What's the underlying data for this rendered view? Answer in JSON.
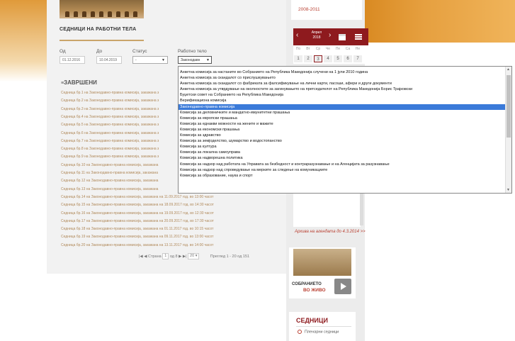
{
  "archive_years": "2008-2011",
  "section_title": "СЕДНИЦИ НА РАБОТНИ ТЕЛА",
  "filters": {
    "from_label": "Од",
    "from_value": "01.12.2016",
    "to_label": "До",
    "to_value": "10.04.2019",
    "status_label": "Статус",
    "status_value": "-",
    "body_label": "Работно тело",
    "body_value": "Законодавн"
  },
  "calendar": {
    "month": "Април",
    "year": "2018",
    "days": [
      "По",
      "Вт",
      "Ср",
      "Че",
      "Пе",
      "Са",
      "Не"
    ],
    "nums": [
      "1",
      "2",
      "3",
      "4",
      "5",
      "6",
      "7"
    ]
  },
  "completed_title": "ЗАВРШЕНИ",
  "sessions": [
    "Седница бр.1 на Законодавно-правна комисија, закажана з",
    "Седница бр.2 на Законодавно-правна комисија, закажана з",
    "Седница бр.3 на Законодавно-правна комисија, закажана з",
    "Седница бр.4 на Законодавно-правна комисија, закажана з",
    "Седница бр.5 на Законодавно-правна комисија, закажана з",
    "Седница бр.6 на Законодавно-правна комисија, закажана з",
    "Седница бр.7 на Законодавно-правна комисија, закажана з",
    "Седница бр.8 на Законодавно-правна комисија, закажана з",
    "Седница бр.9 на Законодавно-правна комисија, закажана з",
    "Седница бр.10 на Законодавно-правна комисија, закажана",
    "Седница бр.11 на Законодавно-правна комисија, закажана",
    "Седница бр.12 на Законодавно-правна комисија, закажана",
    "Седница бр.13 на Законодавно-правна комисија, закажана",
    "Седница бр.14 на Законодавно-правна комисија, закажана на 11.09.2017 год. во 13:00 часот",
    "Седница бр.15 на Законодавно-правна комисија, закажана на 18.09.2017 год. во 14:30 часот",
    "Седница бр.16 на Законодавно-правна комисија, закажана на 19.09.2017 год. во 12:30 часот",
    "Седница бр.17 на Законодавно-правна комисија, закажана на 20.09.2017 год. во 17:30 часот",
    "Седница бр.18 на Законодавно-правна комисија, закажана на 01.11.2017 год. во 10:15 часот",
    "Седница бр.19 на Законодавно-правна комисија, закажана на 09.11.2017 год. во 13:00 часот",
    "Седница бр.20 на Законодавно-правна комисија, закажана на 13.11.2017 год. во 14:00 часот"
  ],
  "pager": {
    "prefix": "Страна",
    "page": "1",
    "of": "од 8",
    "per_page": "20",
    "summary": "Преглед 1 - 20 од 151"
  },
  "dropdown_options": [
    "Анкетна комисија за настаните во Собранието на Република Македонија случени на 1 јули 2010 година",
    "Анкетна комисија за скандалот со прислушкувањето",
    "Анкетна комисија за скандалот со фабриката за фалсификување на лични карти, пасоши, афери и други документи",
    "Анкетна комисија за утврдување на околностите за загинувањето на претседателот на Република Македонија Борис Трајковски",
    "Буџетски совет на Собранието на Република Македонија",
    "Верификациона комисија",
    "Законодавно-правна комисија",
    "Комисија за деловничките и мандатно-имунитетни прашања",
    "Комисија за европски прашања",
    "Комисија за еднакви можности на жените и мажите",
    "Комисија за економски прашања",
    "Комисија за здравство",
    "Комисија за земјоделство, шумарство и водостопанство",
    "Комисија за култура",
    "Комисија за локална самоуправа",
    "Комисија за надворешна политика",
    "Комисија за надзор над работата на Управата за безбедност и контраразузнавање и на Агенцијата за разузнавање",
    "Комисија за надзор над спроведување на мерките за следење на комуникациите",
    "Комисија за образование, наука и спорт"
  ],
  "dropdown_selected_index": 6,
  "agenda_link": "Архива на агендата до 4.3.2014 >>",
  "live": {
    "line1": "СОБРАНИЕТО",
    "line2": "ВО ЖИВО"
  },
  "sessions_box": {
    "title": "СЕДНИЦИ",
    "item": "Пленарни седници"
  },
  "colors": {
    "accent": "#8e1a1e",
    "link": "#b94032",
    "selection": "#3a7ad9"
  }
}
